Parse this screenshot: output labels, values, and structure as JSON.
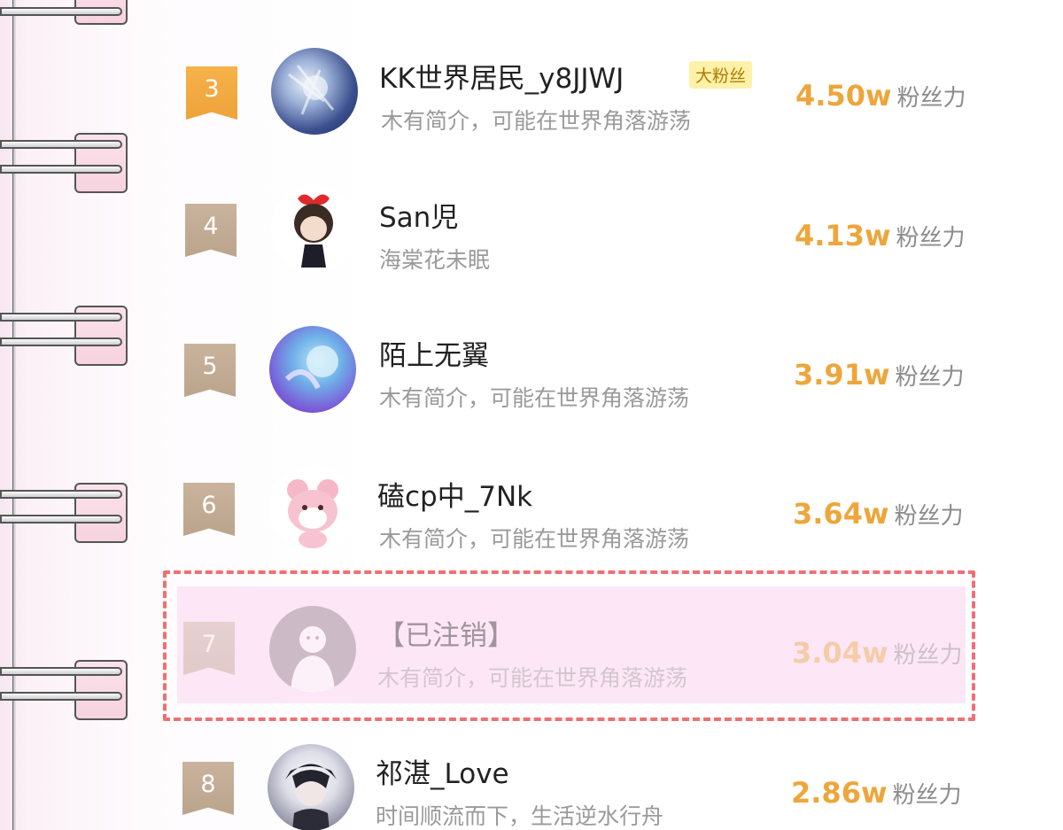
{
  "ranking": {
    "rows": [
      {
        "rank": "3",
        "name": "KK世界居民_y8JJWJ",
        "badge": "大粉丝",
        "bio": "木有简介，可能在世界角落游荡",
        "score": "4.50w",
        "unit": "粉丝力"
      },
      {
        "rank": "4",
        "name": "San児",
        "bio": "海棠花未眠",
        "score": "4.13w",
        "unit": "粉丝力"
      },
      {
        "rank": "5",
        "name": "陌上无翼",
        "bio": "木有简介，可能在世界角落游荡",
        "score": "3.91w",
        "unit": "粉丝力"
      },
      {
        "rank": "6",
        "name": "磕cp中_7Nk",
        "bio": "木有简介，可能在世界角落游荡",
        "score": "3.64w",
        "unit": "粉丝力"
      },
      {
        "rank": "7",
        "name": "【已注销】",
        "bio": "木有简介，可能在世界角落游荡",
        "score": "3.04w",
        "unit": "粉丝力"
      },
      {
        "rank": "8",
        "name": "祁湛_Love",
        "bio": "时间顺流而下，生活逆水行舟",
        "score": "2.86w",
        "unit": "粉丝力"
      }
    ]
  },
  "colors": {
    "gold_rank": "#f6b24a",
    "tan_rank": "#c9b39d",
    "score": "#eda63b",
    "highlight_border": "#f06f73",
    "highlight_fill": "#fde7f6"
  }
}
